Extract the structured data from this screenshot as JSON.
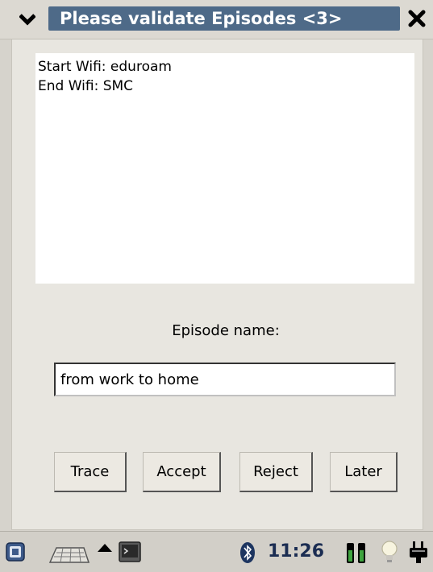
{
  "window": {
    "title": "Please validate Episodes <3>",
    "title_bar_color": "#4e6a88"
  },
  "info_box": {
    "lines": [
      "Start Wifi: eduroam",
      "End Wifi: SMC"
    ]
  },
  "episode_name": {
    "label": "Episode name:",
    "value": "from work to home"
  },
  "buttons": {
    "trace": "Trace",
    "accept": "Accept",
    "reject": "Reject",
    "later": "Later"
  },
  "taskbar": {
    "clock": "11:26",
    "icons": [
      "desktop-icon",
      "keyboard-icon",
      "up-arrow-icon",
      "terminal-icon",
      "bluetooth-icon",
      "battery-icon",
      "lightbulb-icon",
      "power-plug-icon"
    ]
  }
}
